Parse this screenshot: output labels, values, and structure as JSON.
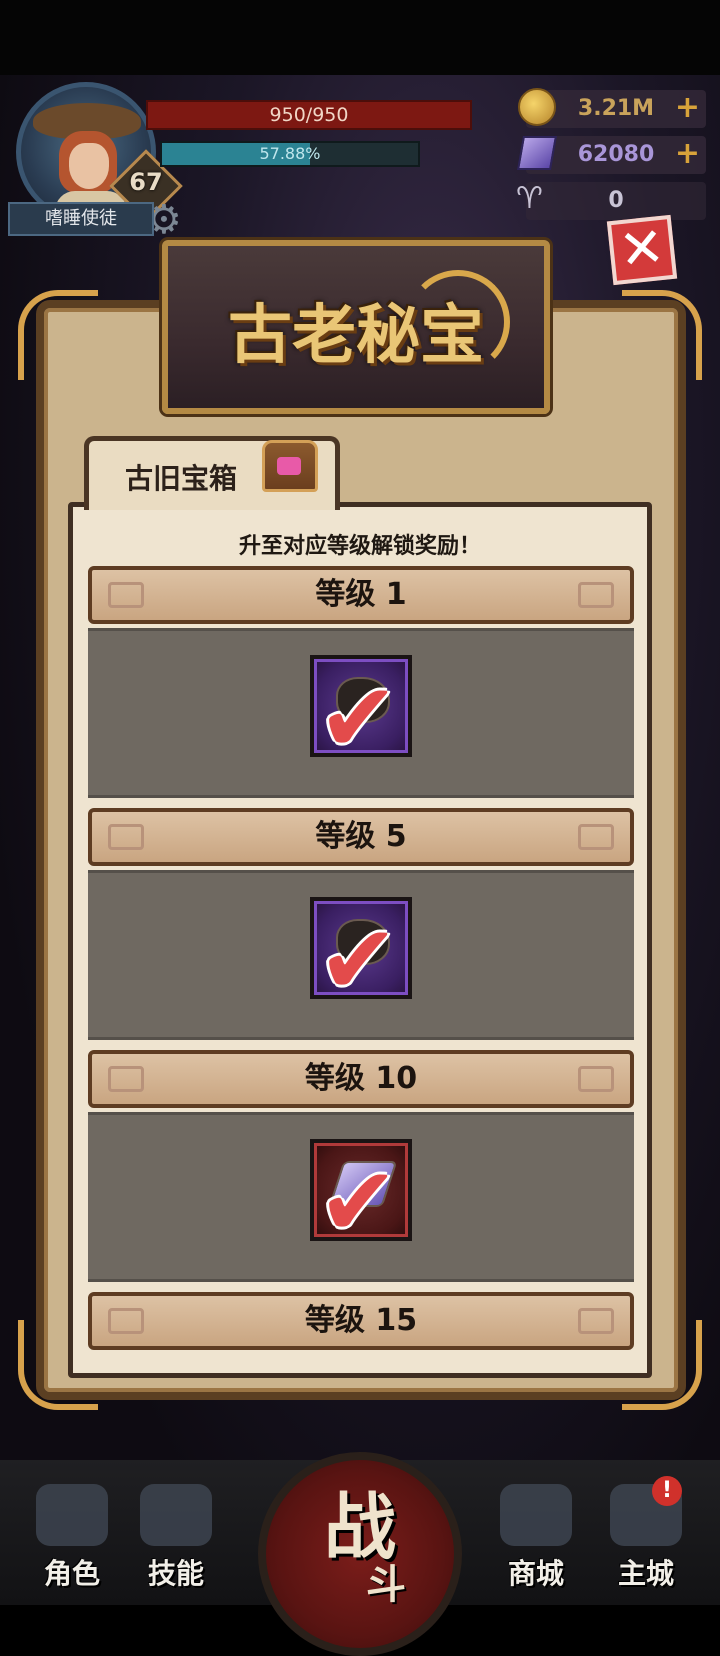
{
  "hud": {
    "player_name": "嗜睡使徒",
    "level": "67",
    "hp_text": "950/950",
    "xp_text": "57.88%",
    "xp_fraction": 0.5788,
    "gold": "3.21M",
    "gems": "62080",
    "horns": "0",
    "plus": "+"
  },
  "modal": {
    "title": "古老秘宝",
    "close_symbol": "✕",
    "tab_label": "古旧宝箱",
    "subtitle": "升至对应等级解锁奖励！",
    "rewards": [
      {
        "level_label": "等级 1",
        "claimed": true,
        "slot": "purple",
        "item": "coin-pouch"
      },
      {
        "level_label": "等级 5",
        "claimed": true,
        "slot": "purple",
        "item": "stone"
      },
      {
        "level_label": "等级 10",
        "claimed": true,
        "slot": "red",
        "item": "crystal"
      },
      {
        "level_label": "等级 15",
        "claimed": false,
        "slot": "purple",
        "item": "unknown"
      }
    ],
    "check_glyph": "✔"
  },
  "nav": {
    "items": [
      {
        "label": "角色",
        "icon": "character-icon"
      },
      {
        "label": "技能",
        "icon": "skill-icon"
      },
      {
        "label": "商城",
        "icon": "shop-icon"
      },
      {
        "label": "主城",
        "icon": "castle-icon"
      }
    ],
    "battle_main": "战",
    "battle_sub": "斗",
    "alert": "!"
  },
  "colors": {
    "hp": "#7d1812",
    "xp": "#2b8393",
    "gold_text": "#c9a35b",
    "close": "#d33a3a",
    "check": "#e34b4b"
  }
}
